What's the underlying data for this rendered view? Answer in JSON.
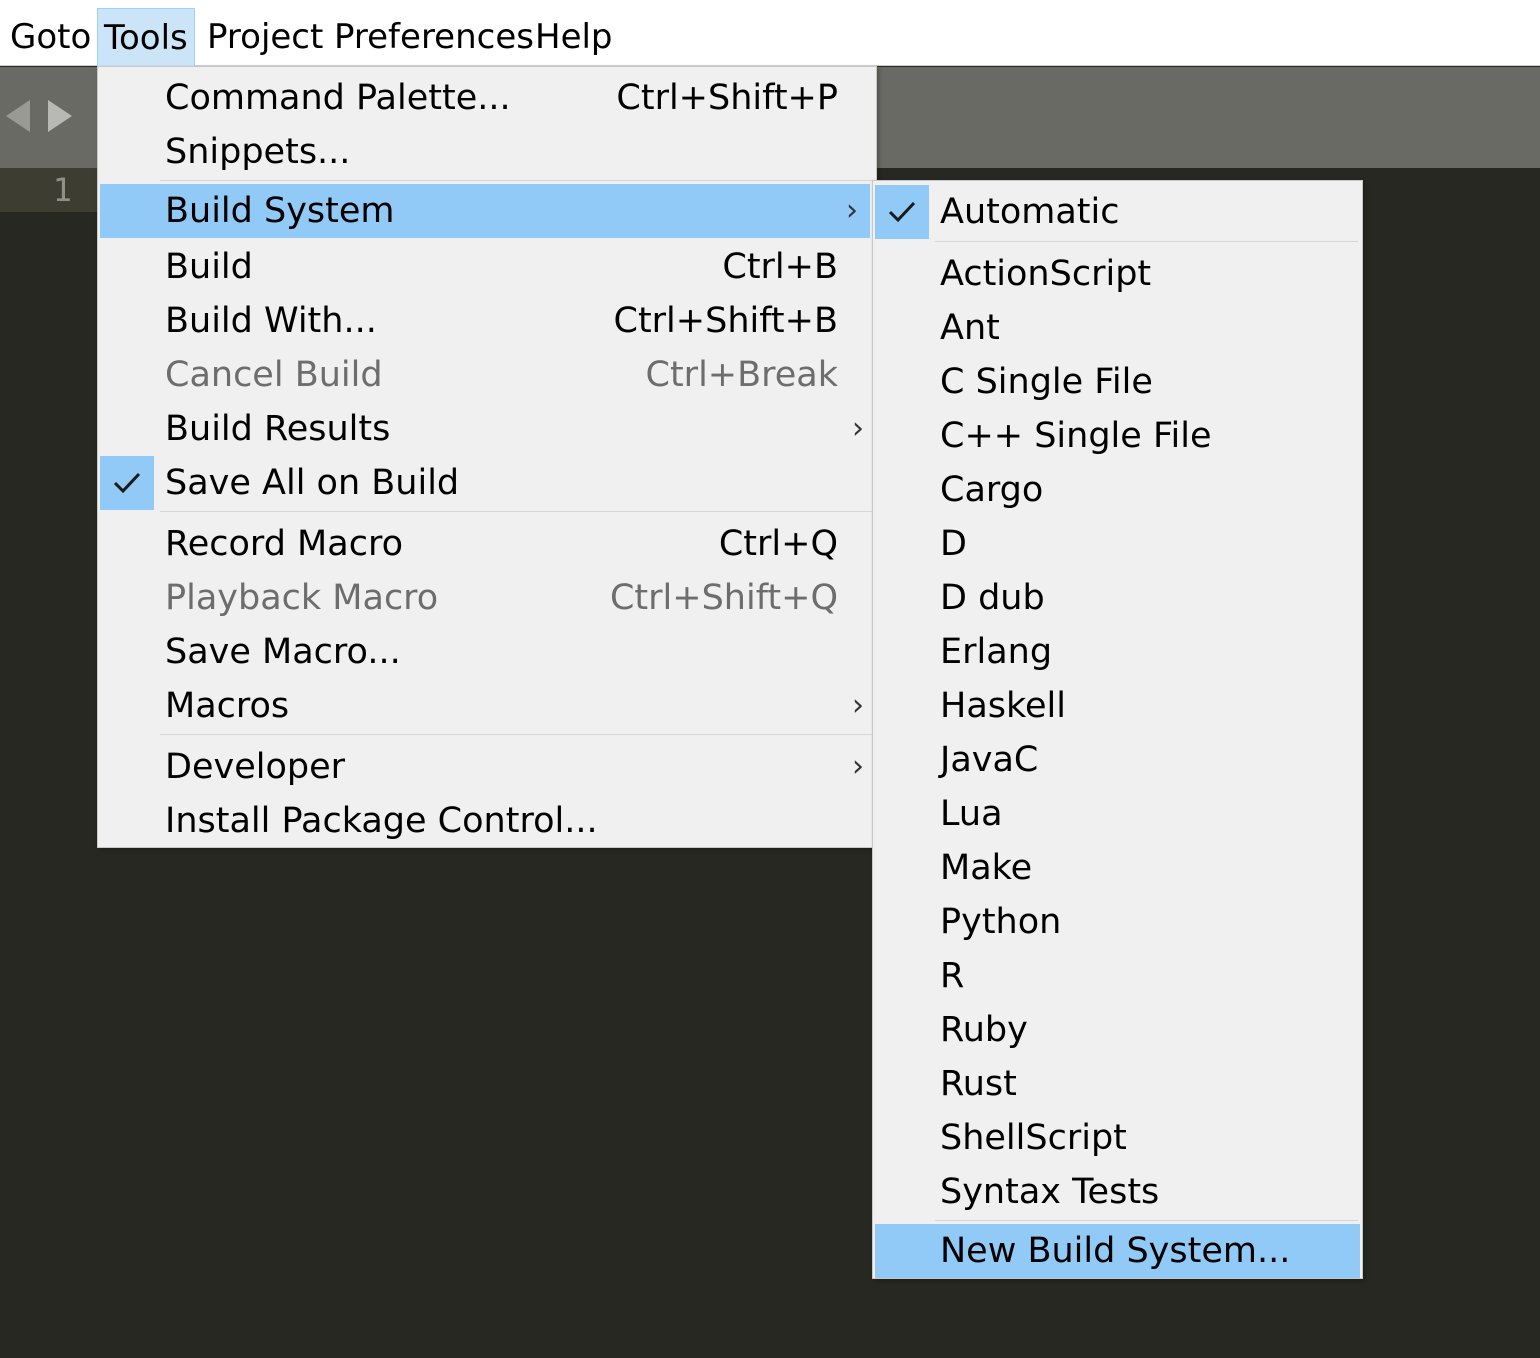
{
  "menubar": {
    "items": [
      "Goto",
      "Tools",
      "Project",
      "Preferences",
      "Help"
    ]
  },
  "editor": {
    "line_number": "1"
  },
  "tools_menu": {
    "items": [
      {
        "label": "Command Palette...",
        "shortcut": "Ctrl+Shift+P"
      },
      {
        "label": "Snippets...",
        "shortcut": ""
      },
      {
        "label": "Build System",
        "shortcut": ""
      },
      {
        "label": "Build",
        "shortcut": "Ctrl+B"
      },
      {
        "label": "Build With...",
        "shortcut": "Ctrl+Shift+B"
      },
      {
        "label": "Cancel Build",
        "shortcut": "Ctrl+Break"
      },
      {
        "label": "Build Results",
        "shortcut": ""
      },
      {
        "label": "Save All on Build",
        "shortcut": ""
      },
      {
        "label": "Record Macro",
        "shortcut": "Ctrl+Q"
      },
      {
        "label": "Playback Macro",
        "shortcut": "Ctrl+Shift+Q"
      },
      {
        "label": "Save Macro...",
        "shortcut": ""
      },
      {
        "label": "Macros",
        "shortcut": ""
      },
      {
        "label": "Developer",
        "shortcut": ""
      },
      {
        "label": "Install Package Control...",
        "shortcut": ""
      }
    ]
  },
  "build_system_menu": {
    "items": [
      "Automatic",
      "ActionScript",
      "Ant",
      "C Single File",
      "C++ Single File",
      "Cargo",
      "D",
      "D dub",
      "Erlang",
      "Haskell",
      "JavaC",
      "Lua",
      "Make",
      "Python",
      "R",
      "Ruby",
      "Rust",
      "ShellScript",
      "Syntax Tests",
      "New Build System..."
    ]
  },
  "colors": {
    "highlight": "#91c9f7",
    "menu_bg": "#f0f0f0",
    "editor_bg": "#272822",
    "tabbar_bg": "#6a6a64"
  }
}
